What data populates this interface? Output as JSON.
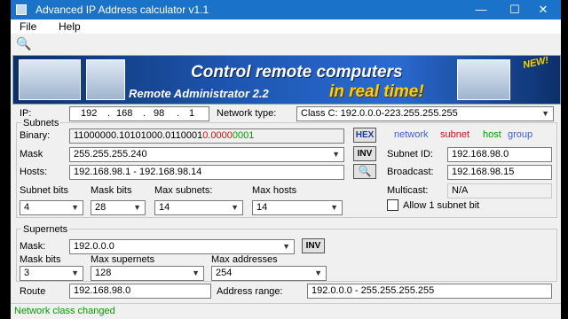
{
  "window": {
    "title": "Advanced IP Address calculator v1.1",
    "minimize": "—",
    "maximize": "☐",
    "close": "✕"
  },
  "menu": {
    "file": "File",
    "help": "Help"
  },
  "banner": {
    "line1": "Control remote computers",
    "line2": "Remote Administrator 2.2",
    "line3": "in real time!",
    "badge": "NEW!"
  },
  "ip": {
    "label": "IP:",
    "octets": [
      "192",
      "168",
      "98",
      "1"
    ],
    "network_type_label": "Network type:",
    "network_type_value": "Class C: 192.0.0.0-223.255.255.255"
  },
  "subnets": {
    "group_label": "Subnets",
    "binary_label": "Binary:",
    "binary_network": "11000000.10101000.0110001",
    "binary_subnet": "0.0000",
    "binary_host": "0001",
    "hex_button": "HEX",
    "legend_network": "network",
    "legend_subnet": "subnet",
    "legend_host": "host",
    "legend_group": "group",
    "mask_label": "Mask",
    "mask_value": "255.255.255.240",
    "inv_button": "INV",
    "hosts_label": "Hosts:",
    "hosts_value": "192.168.98.1 - 192.168.98.14",
    "subnet_id_label": "Subnet ID:",
    "subnet_id_value": "192.168.98.0",
    "broadcast_label": "Broadcast:",
    "broadcast_value": "192.168.98.15",
    "multicast_label": "Multicast:",
    "multicast_value": "N/A",
    "subnet_bits_label": "Subnet bits",
    "subnet_bits_value": "4",
    "mask_bits_label": "Mask bits",
    "mask_bits_value": "28",
    "max_subnets_label": "Max subnets:",
    "max_subnets_value": "14",
    "max_hosts_label": "Max hosts",
    "max_hosts_value": "14",
    "allow_label": "Allow 1 subnet bit"
  },
  "supernets": {
    "group_label": "Supernets",
    "mask_label": "Mask:",
    "mask_value": "192.0.0.0",
    "inv_button": "INV",
    "mask_bits_label": "Mask bits",
    "mask_bits_value": "3",
    "max_supernets_label": "Max supernets",
    "max_supernets_value": "128",
    "max_addresses_label": "Max addresses",
    "max_addresses_value": "254",
    "route_label": "Route",
    "route_value": "192.168.98.0",
    "address_range_label": "Address range:",
    "address_range_value": "192.0.0.0 - 255.255.255.255"
  },
  "status": {
    "text": "Network class changed",
    "color": "#00a000"
  },
  "colors": {
    "network": "#000000",
    "subnet": "#d01010",
    "host": "#00a000",
    "group": "#4060d0",
    "titlebar": "#1a73c8"
  }
}
